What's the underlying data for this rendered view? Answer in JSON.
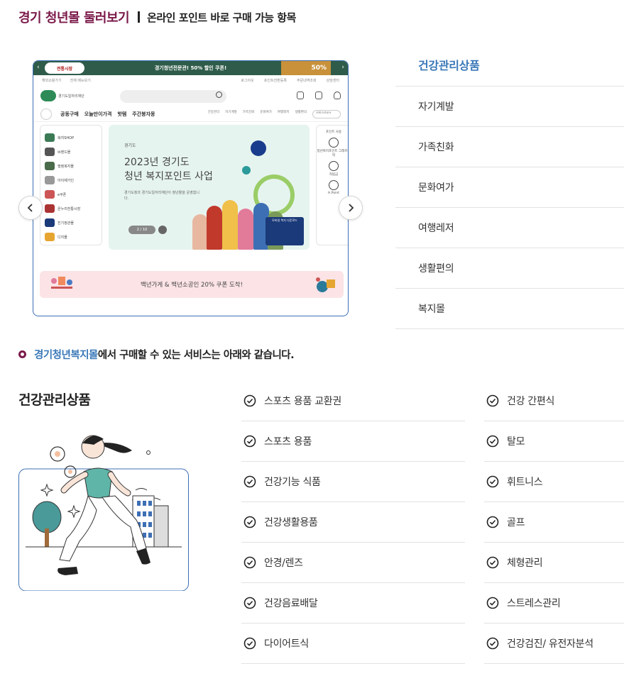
{
  "header": {
    "title": "경기 청년몰 둘러보기",
    "subtitle": "온라인 포인트 바로 구매 가능 항목"
  },
  "screenshot": {
    "topbar_logo": "전통시장",
    "topbar_promo": "경기청년전문관! 50% 할인 쿠폰!",
    "topbar_badge": "50%",
    "util_left": [
      "해외쇼핑가기",
      "전체 메뉴보기"
    ],
    "util_right": [
      "로그아웃",
      "포인트전환등록",
      "주문내역조회",
      "상담센터"
    ],
    "brand_text": "경기도일자리재단",
    "gnb_items": [
      "공동구매",
      "오늘만이가격",
      "핫템",
      "주간봉자몽"
    ],
    "gnb_sub": [
      "건강관리",
      "자기계발",
      "가족친화",
      "문화여가",
      "여행레저",
      "생활편의"
    ],
    "gnb_select": "서비스store",
    "left_menu": [
      "복지SHOP",
      "브랜드몰",
      "행정복지몰",
      "아이제가인",
      "e쿠폰",
      "온누리전통시장",
      "진기정관몰",
      "디지몰"
    ],
    "banner_tag": "경기도",
    "banner_line1": "2023년 경기도",
    "banner_line2": "청년 복지포인트 사업",
    "banner_desc": "경기도청과 경기도일자리재단이 청년몰을 운영합니다.",
    "banner_pager": "2 / 10",
    "qr_label": "모바일 복지 다운로드",
    "right_menu_title": "포인트 사용",
    "right_menu": [
      "청년복지포인트 그래프이력",
      "적립금",
      "H.Point"
    ],
    "strip_text": "백년가게 & 백년소공인 20% 쿠폰 도착!"
  },
  "categories": [
    {
      "label": "건강관리상품",
      "active": true
    },
    {
      "label": "자기계발",
      "active": false
    },
    {
      "label": "가족친화",
      "active": false
    },
    {
      "label": "문화여가",
      "active": false
    },
    {
      "label": "여행레저",
      "active": false
    },
    {
      "label": "생활편의",
      "active": false
    },
    {
      "label": "복지몰",
      "active": false
    }
  ],
  "intro": {
    "highlight": "경기청년복지몰",
    "text": "에서 구매할 수 있는 서비스는 아래와 같습니다."
  },
  "section": {
    "title": "건강관리상품"
  },
  "items_col1": [
    "스포츠 용품 교환권",
    "스포츠 용품",
    "건강기능 식품",
    "건강생활용품",
    "안경/렌즈",
    "건강음료배달",
    "다이어트식"
  ],
  "items_col2": [
    "건강 간편식",
    "탈모",
    "휘트니스",
    "골프",
    "체형관리",
    "스트레스관리",
    "건강검진/ 유전자분석"
  ],
  "colors": {
    "title": "#7b1a4a",
    "accent_blue": "#3a78b8",
    "frame_border": "#3d6fb4"
  },
  "icons": {
    "prev": "chevron-left-icon",
    "next": "chevron-right-icon",
    "check": "check-circle-icon"
  }
}
